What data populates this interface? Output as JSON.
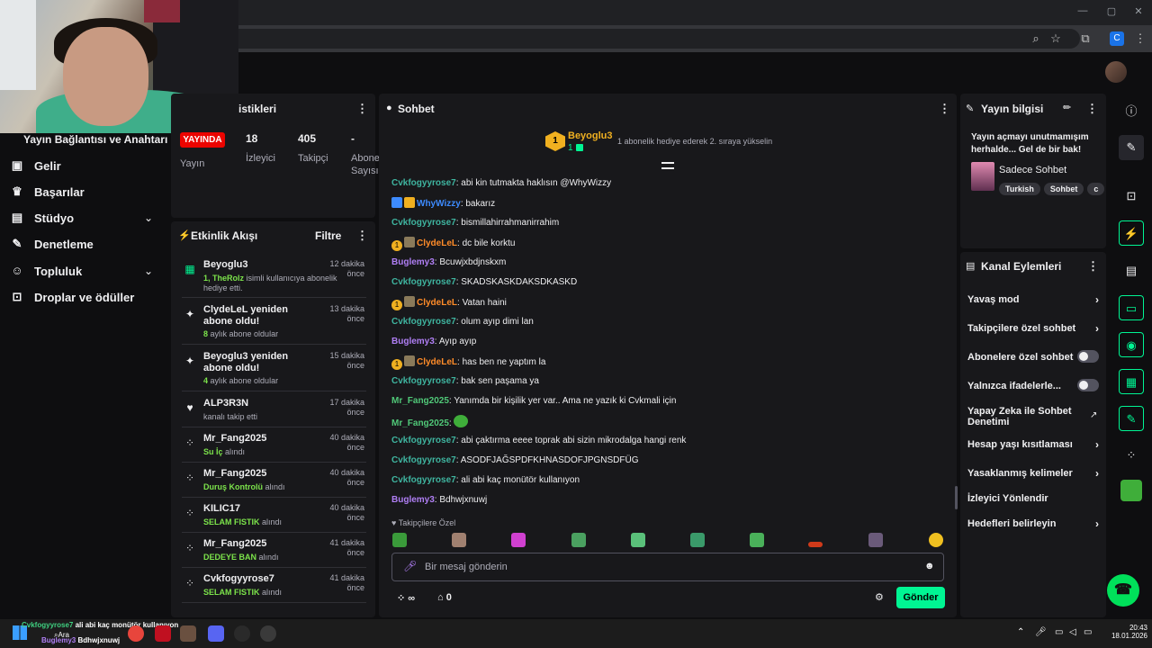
{
  "browser": {
    "ext_badge": "C"
  },
  "sidebar": {
    "header": "Yayın Bağlantısı ve Anahtarı",
    "items": [
      {
        "label": "Gelir",
        "icon": "wallet-icon"
      },
      {
        "label": "Başarılar",
        "icon": "trophy-icon"
      },
      {
        "label": "Stüdyo",
        "icon": "studio-icon"
      },
      {
        "label": "Denetleme",
        "icon": "wrench-icon"
      },
      {
        "label": "Topluluk",
        "icon": "people-icon"
      },
      {
        "label": "Droplar ve ödüller",
        "icon": "drops-icon"
      }
    ]
  },
  "stats": {
    "title": "istikleri",
    "live_label": "YAYINDA",
    "col1_label": "Yayın",
    "viewers_value": "18",
    "viewers_label": "İzleyici",
    "followers_value": "405",
    "followers_label": "Takipçi",
    "subs_value": "-",
    "subs_label_1": "Abone",
    "subs_label_2": "Sayısı"
  },
  "activity": {
    "title": "Etkinlik Akışı",
    "filter_label": "Filtre",
    "items": [
      {
        "name": "Beyoglu3",
        "time": "12 dakika önce",
        "desc_a": "1, ",
        "desc_b": "TheRolz",
        "desc_c": " isimli kullanıcıya abonelik hediye etti."
      },
      {
        "name": "ClydeLeL yeniden abone oldu!",
        "time": "13 dakika önce",
        "desc_a": "8",
        "desc_c": " aylık abone oldular"
      },
      {
        "name": "Beyoglu3 yeniden abone oldu!",
        "time": "15 dakika önce",
        "desc_a": "4",
        "desc_c": " aylık abone oldular"
      },
      {
        "name": "ALP3R3N",
        "time": "17 dakika önce",
        "desc_c": "kanalı takip etti"
      },
      {
        "name": "Mr_Fang2025",
        "time": "40 dakika önce",
        "desc_a": "Su İç",
        "desc_c": " alındı"
      },
      {
        "name": "Mr_Fang2025",
        "time": "40 dakika önce",
        "desc_a": "Duruş Kontrolü",
        "desc_c": " alındı"
      },
      {
        "name": "KILIC17",
        "time": "40 dakika önce",
        "desc_a": "SELAM FISTIK",
        "desc_c": " alındı"
      },
      {
        "name": "Mr_Fang2025",
        "time": "41 dakika önce",
        "desc_a": "DEDEYE BAN",
        "desc_c": " alındı"
      },
      {
        "name": "Cvkfogyyrose7",
        "time": "41 dakika önce",
        "desc_a": "SELAM FISTIK",
        "desc_c": " alındı"
      }
    ]
  },
  "chat": {
    "title": "Sohbet",
    "top_gifter_name": "Beyoglu3",
    "top_gifter_count": "1",
    "gift_hint": "1 abonelik hediye ederek 2. sıraya yükselin",
    "messages": [
      {
        "user": "Cvkfogyyrose7",
        "text": "abi kin tutmakta haklısın @WhyWizzy",
        "color": "teal"
      },
      {
        "user": "WhyWizzy",
        "text": "bakarız",
        "color": "blue"
      },
      {
        "user": "Cvkfogyyrose7",
        "text": "bismillahirrahmanirrahim",
        "color": "teal"
      },
      {
        "user": "ClydeLeL",
        "text": "dc bile korktu",
        "color": "orange"
      },
      {
        "user": "Buglemy3",
        "text": "Bcuwjxbdjnskxm",
        "color": "purple"
      },
      {
        "user": "Cvkfogyyrose7",
        "text": "SKADSKASKDAKSDKASKD",
        "color": "teal"
      },
      {
        "user": "ClydeLeL",
        "text": "Vatan haini",
        "color": "orange"
      },
      {
        "user": "Cvkfogyyrose7",
        "text": "olum ayıp dimi lan",
        "color": "teal"
      },
      {
        "user": "Buglemy3",
        "text": "Ayıp ayıp",
        "color": "purple"
      },
      {
        "user": "ClydeLeL",
        "text": "has ben ne yaptım la",
        "color": "orange"
      },
      {
        "user": "Cvkfogyyrose7",
        "text": "bak sen paşama ya",
        "color": "teal"
      },
      {
        "user": "Mr_Fang2025",
        "text": "Yanımda bir kişilik yer var.. Ama ne yazık ki Cvkmali için",
        "color": "green"
      },
      {
        "user": "Mr_Fang2025",
        "text": "",
        "color": "green"
      },
      {
        "user": "Cvkfogyyrose7",
        "text": "abi çaktırma eeee toprak abi sizin mikrodalga hangi renk",
        "color": "teal"
      },
      {
        "user": "Cvkfogyyrose7",
        "text": "ASODFJAĞSPDFKHNASDOFJPGNSDFÜG",
        "color": "teal"
      },
      {
        "user": "Cvkfogyyrose7",
        "text": "ali abi kaç monütör kullanıyon",
        "color": "teal"
      },
      {
        "user": "Buglemy3",
        "text": "Bdhwjxnuwj",
        "color": "purple"
      }
    ],
    "followers_only_label": "Takipçilere Özel",
    "input_placeholder": "Bir mesaj gönderin",
    "points_value": "∞",
    "store_value": "0",
    "send_label": "Gönder"
  },
  "info": {
    "title": "Yayın bilgisi",
    "stream_title": "Yayın açmayı unutmamışım herhalde... Gel de bir bak!",
    "category": "Sadece Sohbet",
    "tags": [
      "Turkish",
      "Sohbet",
      "c"
    ]
  },
  "actions": {
    "title": "Kanal Eylemleri",
    "rows": [
      {
        "label": "Yavaş mod",
        "kind": "chevron"
      },
      {
        "label": "Takipçilere özel sohbet",
        "kind": "chevron"
      },
      {
        "label": "Abonelere özel sohbet",
        "kind": "toggle"
      },
      {
        "label": "Yalnızca ifadelerle...",
        "kind": "toggle"
      },
      {
        "label": "Yapay Zeka ile Sohbet Denetimi",
        "kind": "external"
      },
      {
        "label": "Hesap yaşı kısıtlaması",
        "kind": "chevron"
      },
      {
        "label": "Yasaklanmış kelimeler",
        "kind": "chevron"
      },
      {
        "label": "İzleyici Yönlendir",
        "kind": "none"
      },
      {
        "label": "Hedefleri belirleyin",
        "kind": "chevron"
      }
    ]
  },
  "taskbar": {
    "overlay_user1": "Cvkfogyyrose7",
    "overlay_msg1": "ali abi kaç monütör kullanıyon",
    "overlay_user2": "Buglemy3",
    "overlay_msg2": "Bdhwjxnuwj",
    "search_label": "Ara",
    "time": "20:43",
    "date": "18.01.2026"
  },
  "colors": {
    "accent": "#00f593",
    "live": "#eb0400",
    "panel": "#18181b"
  }
}
